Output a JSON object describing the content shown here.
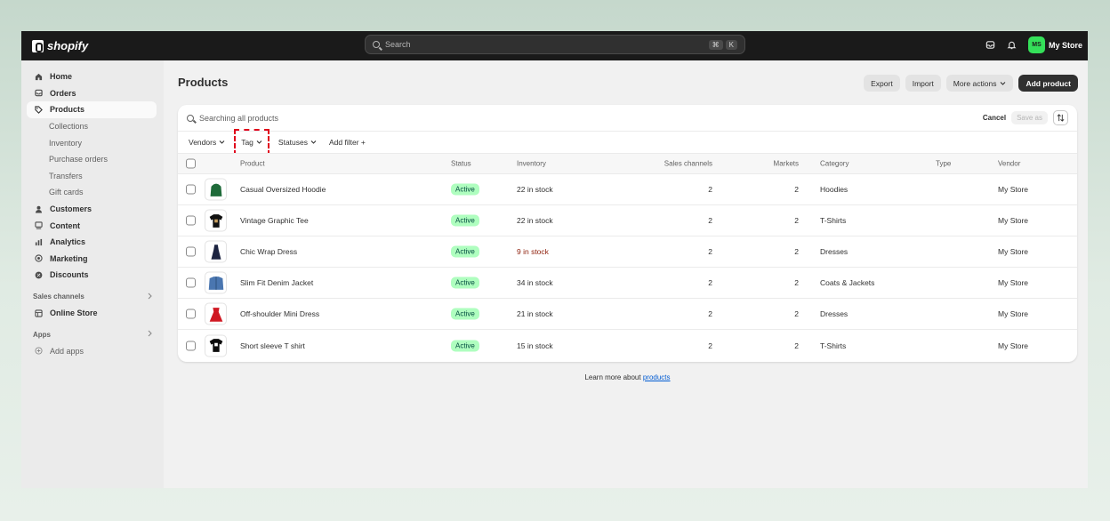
{
  "topbar": {
    "brand": "shopify",
    "search_placeholder": "Search",
    "kbd": [
      "⌘",
      "K"
    ],
    "avatar_initials": "MS",
    "store_name": "My Store"
  },
  "sidebar": {
    "items": [
      {
        "label": "Home",
        "icon": "home-icon"
      },
      {
        "label": "Orders",
        "icon": "orders-icon"
      },
      {
        "label": "Products",
        "icon": "tag-icon",
        "active": true
      },
      {
        "label": "Collections",
        "sub": true
      },
      {
        "label": "Inventory",
        "sub": true
      },
      {
        "label": "Purchase orders",
        "sub": true
      },
      {
        "label": "Transfers",
        "sub": true
      },
      {
        "label": "Gift cards",
        "sub": true
      },
      {
        "label": "Customers",
        "icon": "person-icon"
      },
      {
        "label": "Content",
        "icon": "content-icon"
      },
      {
        "label": "Analytics",
        "icon": "bar-chart-icon"
      },
      {
        "label": "Marketing",
        "icon": "target-icon"
      },
      {
        "label": "Discounts",
        "icon": "discount-icon"
      }
    ],
    "sales_channels_label": "Sales channels",
    "online_store_label": "Online Store",
    "apps_label": "Apps",
    "add_apps_label": "Add apps"
  },
  "page": {
    "title": "Products",
    "export_label": "Export",
    "import_label": "Import",
    "more_actions_label": "More actions",
    "add_product_label": "Add product"
  },
  "table": {
    "search_text": "Searching all products",
    "cancel_label": "Cancel",
    "save_as_label": "Save as",
    "filters": {
      "vendors": "Vendors",
      "tag": "Tag",
      "statuses": "Statuses",
      "add_filter": "Add filter +"
    },
    "headers": {
      "product": "Product",
      "status": "Status",
      "inventory": "Inventory",
      "sales_channels": "Sales channels",
      "markets": "Markets",
      "category": "Category",
      "type": "Type",
      "vendor": "Vendor"
    },
    "rows": [
      {
        "name": "Casual Oversized Hoodie",
        "status": "Active",
        "inventory": "22 in stock",
        "sales_channels": "2",
        "markets": "2",
        "category": "Hoodies",
        "vendor": "My Store",
        "thumb_color": "#1f6b3a"
      },
      {
        "name": "Vintage Graphic Tee",
        "status": "Active",
        "inventory": "22 in stock",
        "sales_channels": "2",
        "markets": "2",
        "category": "T-Shirts",
        "vendor": "My Store",
        "thumb_color": "#111111"
      },
      {
        "name": "Chic Wrap Dress",
        "status": "Active",
        "inventory": "9 in stock",
        "low": true,
        "sales_channels": "2",
        "markets": "2",
        "category": "Dresses",
        "vendor": "My Store",
        "thumb_color": "#1c2340"
      },
      {
        "name": "Slim Fit Denim Jacket",
        "status": "Active",
        "inventory": "34 in stock",
        "sales_channels": "2",
        "markets": "2",
        "category": "Coats & Jackets",
        "vendor": "My Store",
        "thumb_color": "#4a76b0"
      },
      {
        "name": "Off-shoulder Mini Dress",
        "status": "Active",
        "inventory": "21 in stock",
        "sales_channels": "2",
        "markets": "2",
        "category": "Dresses",
        "vendor": "My Store",
        "thumb_color": "#d01822"
      },
      {
        "name": "Short sleeve T shirt",
        "status": "Active",
        "inventory": "15 in stock",
        "sales_channels": "2",
        "markets": "2",
        "category": "T-Shirts",
        "vendor": "My Store",
        "thumb_color": "#0c0c0c"
      }
    ]
  },
  "footer": {
    "text": "Learn more about",
    "link": "products"
  },
  "colors": {
    "badge_bg": "#affebf",
    "low_stock": "#8e1f0b",
    "highlight": "#e0001b"
  }
}
